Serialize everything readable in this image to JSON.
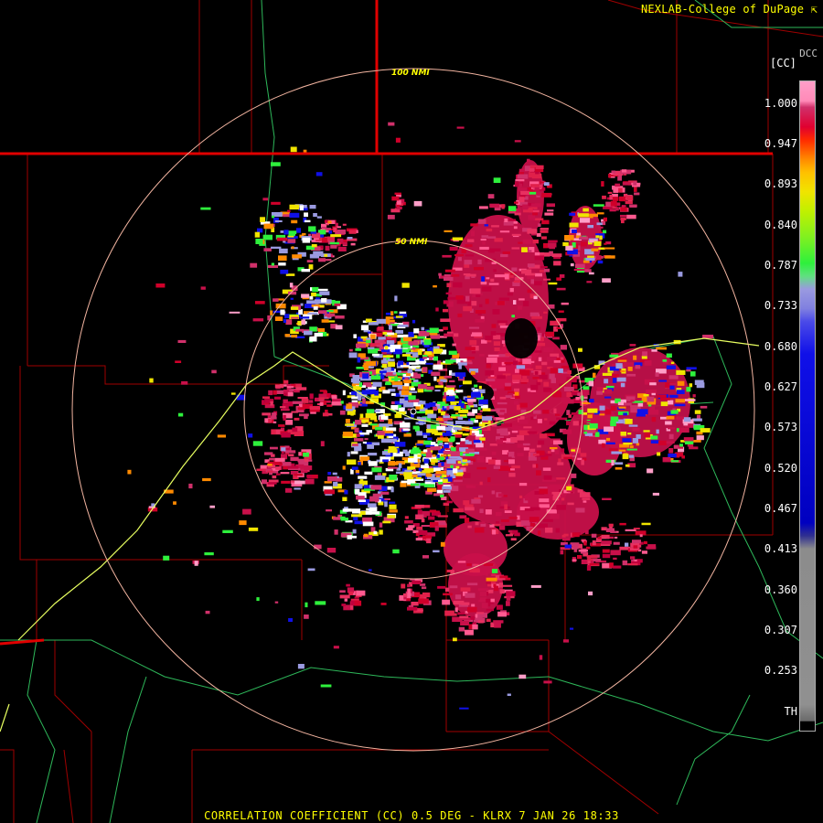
{
  "header": {
    "credit": "NEXLAB-College of DuPage ⇱",
    "corner_label": "DCC"
  },
  "rings": [
    {
      "label": "100 NMI"
    },
    {
      "label": "50 NMI"
    }
  ],
  "legend": {
    "unit": "[CC]",
    "ticks": [
      "1.000",
      "0.947",
      "0.893",
      "0.840",
      "0.787",
      "0.733",
      "0.680",
      "0.627",
      "0.573",
      "0.520",
      "0.467",
      "0.413",
      "0.360",
      "0.307",
      "0.253",
      "TH"
    ],
    "range": [
      0.2,
      1.0
    ],
    "colors": {
      "pink_high": "#ff9ec8",
      "red": "#d0002a",
      "orange": "#ff8a00",
      "yellow": "#f0e400",
      "green": "#2ef03c",
      "lavender": "#9a9ae0",
      "blue": "#1010e8",
      "gray": "#8c8c8c"
    }
  },
  "colors": {
    "background": "#000000",
    "state_border": "#e00000",
    "county_line": "#a00000",
    "highway": "#2eb85a",
    "river": "#e8ff60",
    "range_ring": "#f2b4a0",
    "text_yellow": "#ffff00"
  },
  "footer": {
    "caption": "CORRELATION COEFFICIENT (CC) 0.5 DEG - KLRX 7 JAN 26 18:33"
  }
}
